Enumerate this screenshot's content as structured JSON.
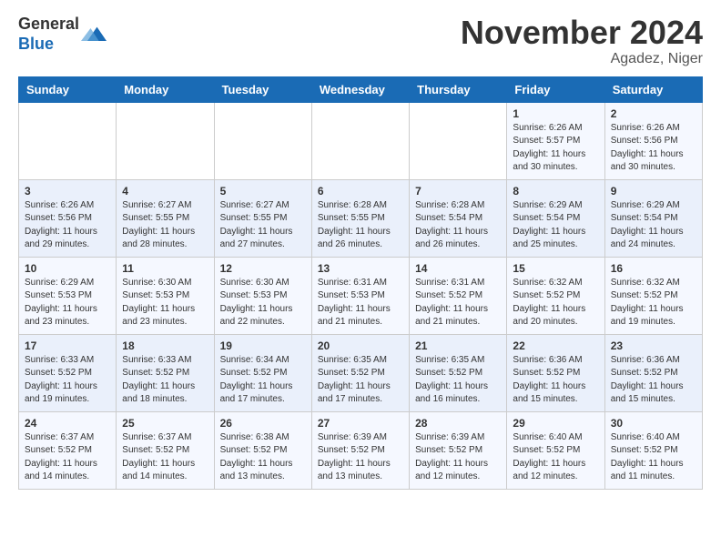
{
  "header": {
    "logo_line1": "General",
    "logo_line2": "Blue",
    "month_title": "November 2024",
    "location": "Agadez, Niger"
  },
  "weekdays": [
    "Sunday",
    "Monday",
    "Tuesday",
    "Wednesday",
    "Thursday",
    "Friday",
    "Saturday"
  ],
  "weeks": [
    [
      {
        "day": "",
        "info": ""
      },
      {
        "day": "",
        "info": ""
      },
      {
        "day": "",
        "info": ""
      },
      {
        "day": "",
        "info": ""
      },
      {
        "day": "",
        "info": ""
      },
      {
        "day": "1",
        "info": "Sunrise: 6:26 AM\nSunset: 5:57 PM\nDaylight: 11 hours\nand 30 minutes."
      },
      {
        "day": "2",
        "info": "Sunrise: 6:26 AM\nSunset: 5:56 PM\nDaylight: 11 hours\nand 30 minutes."
      }
    ],
    [
      {
        "day": "3",
        "info": "Sunrise: 6:26 AM\nSunset: 5:56 PM\nDaylight: 11 hours\nand 29 minutes."
      },
      {
        "day": "4",
        "info": "Sunrise: 6:27 AM\nSunset: 5:55 PM\nDaylight: 11 hours\nand 28 minutes."
      },
      {
        "day": "5",
        "info": "Sunrise: 6:27 AM\nSunset: 5:55 PM\nDaylight: 11 hours\nand 27 minutes."
      },
      {
        "day": "6",
        "info": "Sunrise: 6:28 AM\nSunset: 5:55 PM\nDaylight: 11 hours\nand 26 minutes."
      },
      {
        "day": "7",
        "info": "Sunrise: 6:28 AM\nSunset: 5:54 PM\nDaylight: 11 hours\nand 26 minutes."
      },
      {
        "day": "8",
        "info": "Sunrise: 6:29 AM\nSunset: 5:54 PM\nDaylight: 11 hours\nand 25 minutes."
      },
      {
        "day": "9",
        "info": "Sunrise: 6:29 AM\nSunset: 5:54 PM\nDaylight: 11 hours\nand 24 minutes."
      }
    ],
    [
      {
        "day": "10",
        "info": "Sunrise: 6:29 AM\nSunset: 5:53 PM\nDaylight: 11 hours\nand 23 minutes."
      },
      {
        "day": "11",
        "info": "Sunrise: 6:30 AM\nSunset: 5:53 PM\nDaylight: 11 hours\nand 23 minutes."
      },
      {
        "day": "12",
        "info": "Sunrise: 6:30 AM\nSunset: 5:53 PM\nDaylight: 11 hours\nand 22 minutes."
      },
      {
        "day": "13",
        "info": "Sunrise: 6:31 AM\nSunset: 5:53 PM\nDaylight: 11 hours\nand 21 minutes."
      },
      {
        "day": "14",
        "info": "Sunrise: 6:31 AM\nSunset: 5:52 PM\nDaylight: 11 hours\nand 21 minutes."
      },
      {
        "day": "15",
        "info": "Sunrise: 6:32 AM\nSunset: 5:52 PM\nDaylight: 11 hours\nand 20 minutes."
      },
      {
        "day": "16",
        "info": "Sunrise: 6:32 AM\nSunset: 5:52 PM\nDaylight: 11 hours\nand 19 minutes."
      }
    ],
    [
      {
        "day": "17",
        "info": "Sunrise: 6:33 AM\nSunset: 5:52 PM\nDaylight: 11 hours\nand 19 minutes."
      },
      {
        "day": "18",
        "info": "Sunrise: 6:33 AM\nSunset: 5:52 PM\nDaylight: 11 hours\nand 18 minutes."
      },
      {
        "day": "19",
        "info": "Sunrise: 6:34 AM\nSunset: 5:52 PM\nDaylight: 11 hours\nand 17 minutes."
      },
      {
        "day": "20",
        "info": "Sunrise: 6:35 AM\nSunset: 5:52 PM\nDaylight: 11 hours\nand 17 minutes."
      },
      {
        "day": "21",
        "info": "Sunrise: 6:35 AM\nSunset: 5:52 PM\nDaylight: 11 hours\nand 16 minutes."
      },
      {
        "day": "22",
        "info": "Sunrise: 6:36 AM\nSunset: 5:52 PM\nDaylight: 11 hours\nand 15 minutes."
      },
      {
        "day": "23",
        "info": "Sunrise: 6:36 AM\nSunset: 5:52 PM\nDaylight: 11 hours\nand 15 minutes."
      }
    ],
    [
      {
        "day": "24",
        "info": "Sunrise: 6:37 AM\nSunset: 5:52 PM\nDaylight: 11 hours\nand 14 minutes."
      },
      {
        "day": "25",
        "info": "Sunrise: 6:37 AM\nSunset: 5:52 PM\nDaylight: 11 hours\nand 14 minutes."
      },
      {
        "day": "26",
        "info": "Sunrise: 6:38 AM\nSunset: 5:52 PM\nDaylight: 11 hours\nand 13 minutes."
      },
      {
        "day": "27",
        "info": "Sunrise: 6:39 AM\nSunset: 5:52 PM\nDaylight: 11 hours\nand 13 minutes."
      },
      {
        "day": "28",
        "info": "Sunrise: 6:39 AM\nSunset: 5:52 PM\nDaylight: 11 hours\nand 12 minutes."
      },
      {
        "day": "29",
        "info": "Sunrise: 6:40 AM\nSunset: 5:52 PM\nDaylight: 11 hours\nand 12 minutes."
      },
      {
        "day": "30",
        "info": "Sunrise: 6:40 AM\nSunset: 5:52 PM\nDaylight: 11 hours\nand 11 minutes."
      }
    ]
  ]
}
